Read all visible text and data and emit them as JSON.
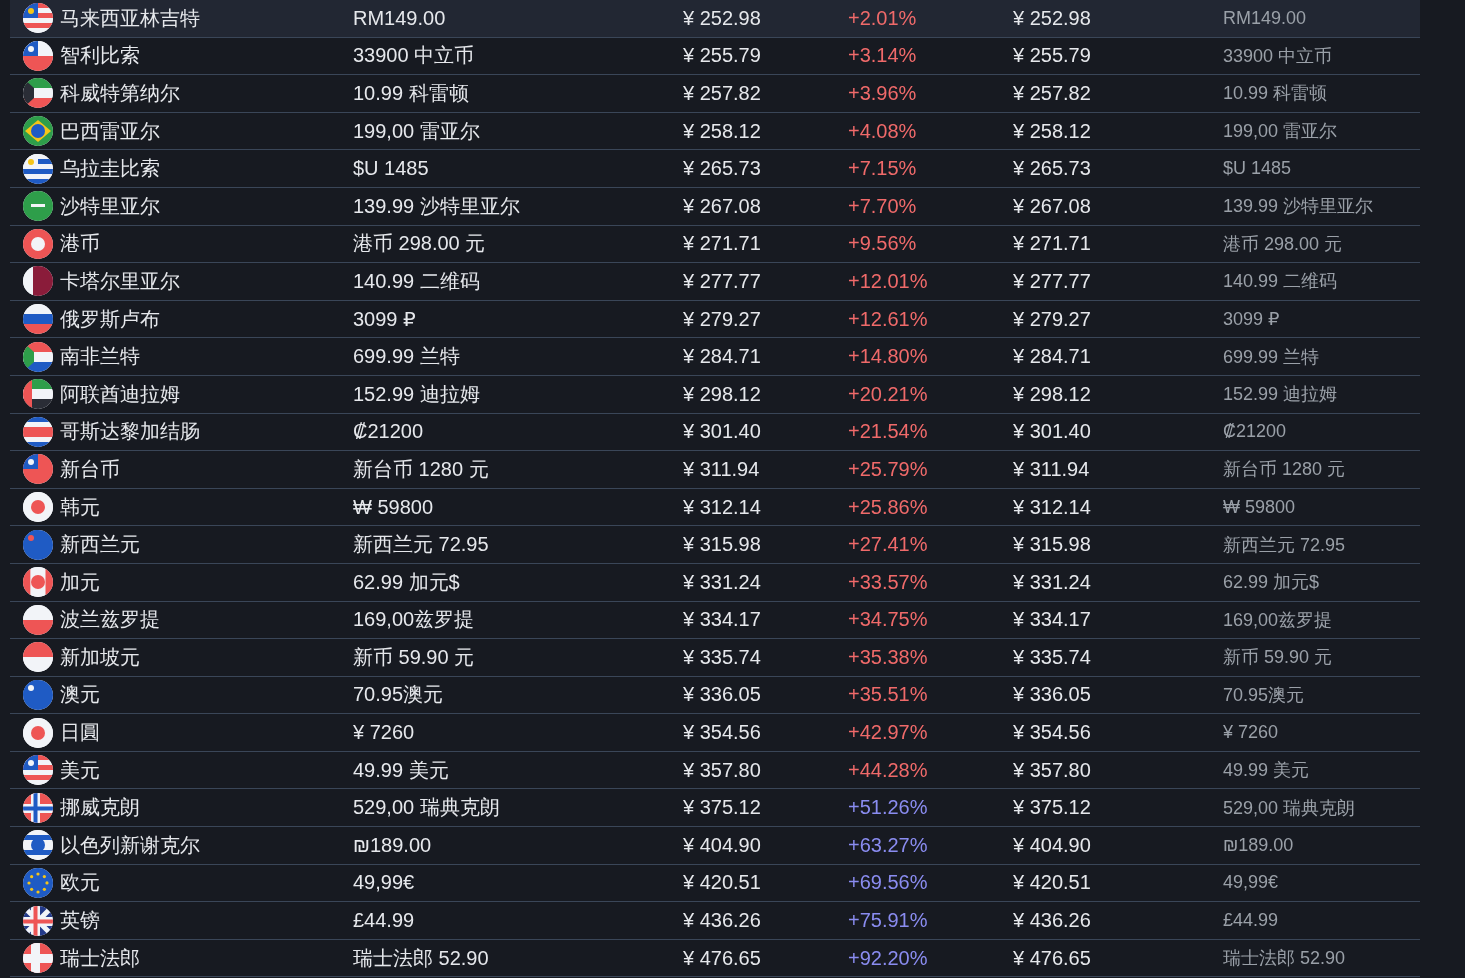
{
  "rows": [
    {
      "kind": "malaysia",
      "selected": true,
      "currency": "马来西亚林吉特",
      "local_price": "RM149.00",
      "converted_price": "¥ 252.98",
      "difference": "+2.01%",
      "color": "#f06a6a",
      "column_5": "¥ 252.98",
      "column_6": "RM149.00"
    },
    {
      "kind": "chile",
      "selected": false,
      "currency": "智利比索",
      "local_price": "33900 中立币",
      "converted_price": "¥ 255.79",
      "difference": "+3.14%",
      "color": "#f06a6a",
      "column_5": "¥ 255.79",
      "column_6": "33900 中立币"
    },
    {
      "kind": "kuwait",
      "selected": false,
      "currency": "科威特第纳尔",
      "local_price": "10.99 科雷顿",
      "converted_price": "¥ 257.82",
      "difference": "+3.96%",
      "color": "#f06a6a",
      "column_5": "¥ 257.82",
      "column_6": "10.99 科雷顿"
    },
    {
      "kind": "brazil",
      "selected": false,
      "currency": "巴西雷亚尔",
      "local_price": "199,00 雷亚尔",
      "converted_price": "¥ 258.12",
      "difference": "+4.08%",
      "color": "#f06a6a",
      "column_5": "¥ 258.12",
      "column_6": "199,00 雷亚尔"
    },
    {
      "kind": "uruguay",
      "selected": false,
      "currency": "乌拉圭比索",
      "local_price": "$U 1485",
      "converted_price": "¥ 265.73",
      "difference": "+7.15%",
      "color": "#f06a6a",
      "column_5": "¥ 265.73",
      "column_6": "$U 1485"
    },
    {
      "kind": "saudi",
      "selected": false,
      "currency": "沙特里亚尔",
      "local_price": "139.99 沙特里亚尔",
      "converted_price": "¥ 267.08",
      "difference": "+7.70%",
      "color": "#f06a6a",
      "column_5": "¥ 267.08",
      "column_6": "139.99 沙特里亚尔"
    },
    {
      "kind": "hongkong",
      "selected": false,
      "currency": "港币",
      "local_price": "港币 298.00 元",
      "converted_price": "¥ 271.71",
      "difference": "+9.56%",
      "color": "#f06a6a",
      "column_5": "¥ 271.71",
      "column_6": "港币 298.00 元"
    },
    {
      "kind": "qatar",
      "selected": false,
      "currency": "卡塔尔里亚尔",
      "local_price": "140.99 二维码",
      "converted_price": "¥ 277.77",
      "difference": "+12.01%",
      "color": "#f06a6a",
      "column_5": "¥ 277.77",
      "column_6": "140.99 二维码"
    },
    {
      "kind": "russia",
      "selected": false,
      "currency": "俄罗斯卢布",
      "local_price": "3099 ₽",
      "converted_price": "¥ 279.27",
      "difference": "+12.61%",
      "color": "#f06a6a",
      "column_5": "¥ 279.27",
      "column_6": "3099 ₽"
    },
    {
      "kind": "southafrica",
      "selected": false,
      "currency": "南非兰特",
      "local_price": "699.99 兰特",
      "converted_price": "¥ 284.71",
      "difference": "+14.80%",
      "color": "#f06a6a",
      "column_5": "¥ 284.71",
      "column_6": "699.99 兰特"
    },
    {
      "kind": "uae",
      "selected": false,
      "currency": "阿联酋迪拉姆",
      "local_price": "152.99 迪拉姆",
      "converted_price": "¥ 298.12",
      "difference": "+20.21%",
      "color": "#f06a6a",
      "column_5": "¥ 298.12",
      "column_6": "152.99 迪拉姆"
    },
    {
      "kind": "costarica",
      "selected": false,
      "currency": "哥斯达黎加结肠",
      "local_price": "₡21200",
      "converted_price": "¥ 301.40",
      "difference": "+21.54%",
      "color": "#f06a6a",
      "column_5": "¥ 301.40",
      "column_6": "₡21200"
    },
    {
      "kind": "taiwan",
      "selected": false,
      "currency": "新台币",
      "local_price": "新台币 1280 元",
      "converted_price": "¥ 311.94",
      "difference": "+25.79%",
      "color": "#f06a6a",
      "column_5": "¥ 311.94",
      "column_6": "新台币 1280 元"
    },
    {
      "kind": "korea",
      "selected": false,
      "currency": "韩元",
      "local_price": "₩ 59800",
      "converted_price": "¥ 312.14",
      "difference": "+25.86%",
      "color": "#f06a6a",
      "column_5": "¥ 312.14",
      "column_6": "₩ 59800"
    },
    {
      "kind": "newzealand",
      "selected": false,
      "currency": "新西兰元",
      "local_price": "新西兰元 72.95",
      "converted_price": "¥ 315.98",
      "difference": "+27.41%",
      "color": "#f06a6a",
      "column_5": "¥ 315.98",
      "column_6": "新西兰元 72.95"
    },
    {
      "kind": "canada",
      "selected": false,
      "currency": "加元",
      "local_price": "62.99 加元$",
      "converted_price": "¥ 331.24",
      "difference": "+33.57%",
      "color": "#f06a6a",
      "column_5": "¥ 331.24",
      "column_6": "62.99 加元$"
    },
    {
      "kind": "poland",
      "selected": false,
      "currency": "波兰兹罗提",
      "local_price": "169,00兹罗提",
      "converted_price": "¥ 334.17",
      "difference": "+34.75%",
      "color": "#f06a6a",
      "column_5": "¥ 334.17",
      "column_6": "169,00兹罗提"
    },
    {
      "kind": "singapore",
      "selected": false,
      "currency": "新加坡元",
      "local_price": "新币 59.90 元",
      "converted_price": "¥ 335.74",
      "difference": "+35.38%",
      "color": "#f06a6a",
      "column_5": "¥ 335.74",
      "column_6": "新币 59.90 元"
    },
    {
      "kind": "australia",
      "selected": false,
      "currency": "澳元",
      "local_price": "70.95澳元",
      "converted_price": "¥ 336.05",
      "difference": "+35.51%",
      "color": "#f06a6a",
      "column_5": "¥ 336.05",
      "column_6": "70.95澳元"
    },
    {
      "kind": "japan",
      "selected": false,
      "currency": "日圓",
      "local_price": "¥ 7260",
      "converted_price": "¥ 354.56",
      "difference": "+42.97%",
      "color": "#f06a6a",
      "column_5": "¥ 354.56",
      "column_6": "¥ 7260"
    },
    {
      "kind": "usa",
      "selected": false,
      "currency": "美元",
      "local_price": "49.99 美元",
      "converted_price": "¥ 357.80",
      "difference": "+44.28%",
      "color": "#f06a6a",
      "column_5": "¥ 357.80",
      "column_6": "49.99 美元"
    },
    {
      "kind": "norway",
      "selected": false,
      "currency": "挪威克朗",
      "local_price": "529,00 瑞典克朗",
      "converted_price": "¥ 375.12",
      "difference": "+51.26%",
      "color": "#8a8cf0",
      "column_5": "¥ 375.12",
      "column_6": "529,00 瑞典克朗"
    },
    {
      "kind": "israel",
      "selected": false,
      "currency": "以色列新谢克尔",
      "local_price": "₪189.00",
      "converted_price": "¥ 404.90",
      "difference": "+63.27%",
      "color": "#8a8cf0",
      "column_5": "¥ 404.90",
      "column_6": "₪189.00"
    },
    {
      "kind": "europe",
      "selected": false,
      "currency": "欧元",
      "local_price": "49,99€",
      "converted_price": "¥ 420.51",
      "difference": "+69.56%",
      "color": "#8a8cf0",
      "column_5": "¥ 420.51",
      "column_6": "49,99€"
    },
    {
      "kind": "uk",
      "selected": false,
      "currency": "英镑",
      "local_price": "£44.99",
      "converted_price": "¥ 436.26",
      "difference": "+75.91%",
      "color": "#8a8cf0",
      "column_5": "¥ 436.26",
      "column_6": "£44.99"
    },
    {
      "kind": "switzerland",
      "selected": false,
      "currency": "瑞士法郎",
      "local_price": "瑞士法郎 52.90",
      "converted_price": "¥ 476.65",
      "difference": "+92.20%",
      "color": "#8a8cf0",
      "column_5": "¥ 476.65",
      "column_6": "瑞士法郎 52.90"
    }
  ]
}
